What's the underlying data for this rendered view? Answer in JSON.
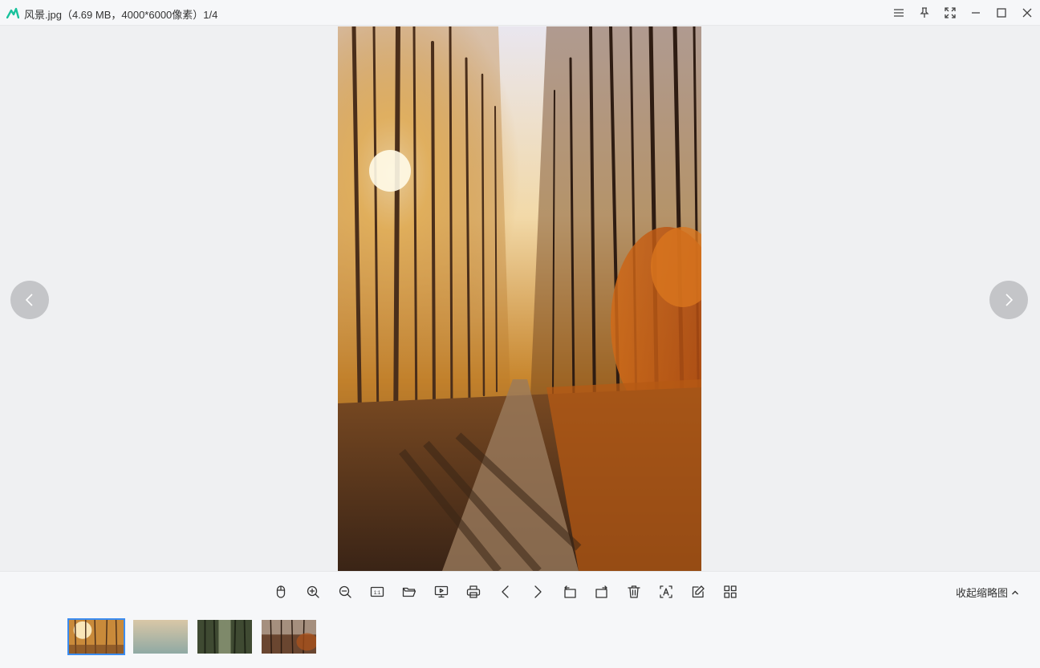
{
  "window": {
    "title": "风景.jpg（4.69 MB，4000*6000像素）1/4",
    "logo_icon": "app-logo-icon",
    "buttons": [
      "menu-icon",
      "pin-icon",
      "fullscreen-icon",
      "minimize-icon",
      "maximize-icon",
      "close-icon"
    ]
  },
  "viewer": {
    "image_name": "风景.jpg",
    "prev_icon": "chevron-left-icon",
    "next_icon": "chevron-right-icon"
  },
  "toolbar": {
    "tools": [
      "mouse-icon",
      "zoom-in-icon",
      "zoom-out-icon",
      "actual-size-icon",
      "open-folder-icon",
      "slideshow-icon",
      "print-icon",
      "previous-icon",
      "next-icon",
      "rotate-left-icon",
      "rotate-right-icon",
      "delete-icon",
      "ocr-icon",
      "edit-icon",
      "grid-view-icon"
    ],
    "actual_size_label": "1:1",
    "collapse_label": "收起缩略图"
  },
  "thumbnails": [
    {
      "name": "thumb-1",
      "active": true
    },
    {
      "name": "thumb-2",
      "active": false
    },
    {
      "name": "thumb-3",
      "active": false
    },
    {
      "name": "thumb-4",
      "active": false
    }
  ],
  "colors": {
    "accent": "#3b8cf0",
    "logo": "#18c29c",
    "background": "#eff0f2"
  }
}
